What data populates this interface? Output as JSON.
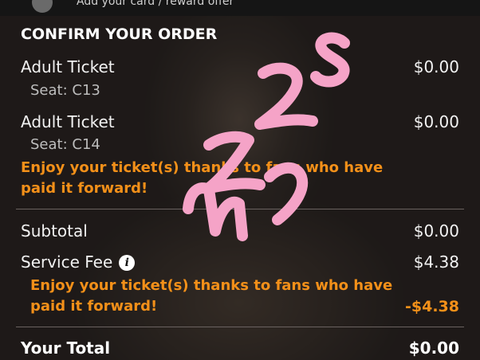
{
  "header": {
    "partial_text": "Add your card / reward offer"
  },
  "order": {
    "title": "CONFIRM YOUR ORDER",
    "tickets": [
      {
        "label": "Adult Ticket",
        "seat": "Seat: C13",
        "price": "$0.00"
      },
      {
        "label": "Adult Ticket",
        "seat": "Seat: C14",
        "price": "$0.00"
      }
    ],
    "promo_tickets": "Enjoy your ticket(s) thanks to fans who have paid it forward!",
    "subtotal_label": "Subtotal",
    "subtotal_value": "$0.00",
    "service_fee_label": "Service Fee",
    "service_fee_value": "$4.38",
    "info_icon_glyph": "i",
    "promo_fee": "Enjoy your ticket(s) thanks to fans who have paid it forward!",
    "fee_discount": "-$4.38",
    "total_label": "Your Total",
    "total_value": "$0.00"
  },
  "colors": {
    "accent_orange": "#f39019",
    "scribble_pink": "#f5a3c7"
  },
  "icons": [
    "info-icon"
  ]
}
